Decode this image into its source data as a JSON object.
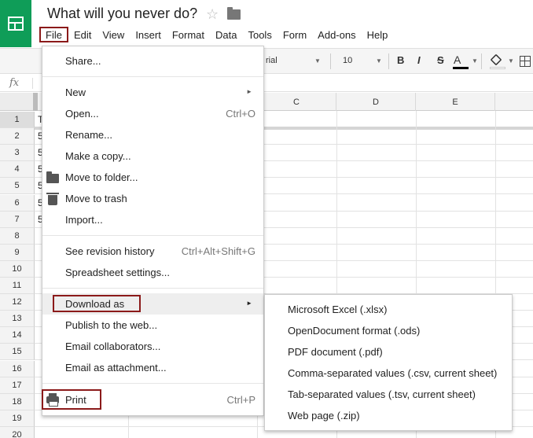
{
  "app": {
    "doc_title": "What will you never do?",
    "logo_icon": "sheets-logo-icon",
    "accent_color": "#0f9d58"
  },
  "menubar": [
    "File",
    "Edit",
    "View",
    "Insert",
    "Format",
    "Data",
    "Tools",
    "Form",
    "Add-ons",
    "Help"
  ],
  "toolbar": {
    "font": "rial",
    "font_size": "10",
    "bold": "B",
    "italic": "I",
    "strike": "S",
    "text_color": "A"
  },
  "formula": {
    "fx": "fx"
  },
  "grid": {
    "columns": [
      "C",
      "D",
      "E"
    ],
    "rows": [
      "1",
      "2",
      "3",
      "4",
      "5",
      "6",
      "7",
      "8",
      "9",
      "10",
      "11",
      "12",
      "13",
      "14",
      "15",
      "16",
      "17",
      "18",
      "19",
      "20"
    ],
    "a_cell_chars": [
      "T",
      "5",
      "5",
      "5",
      "5",
      "5",
      "5"
    ]
  },
  "file_menu": {
    "share": "Share...",
    "new": "New",
    "open": "Open...",
    "open_shortcut": "Ctrl+O",
    "rename": "Rename...",
    "copy": "Make a copy...",
    "move": "Move to folder...",
    "trash": "Move to trash",
    "import": "Import...",
    "revision": "See revision history",
    "revision_shortcut": "Ctrl+Alt+Shift+G",
    "settings": "Spreadsheet settings...",
    "download": "Download as",
    "publish": "Publish to the web...",
    "email_collab": "Email collaborators...",
    "email_attach": "Email as attachment...",
    "print": "Print",
    "print_shortcut": "Ctrl+P"
  },
  "download_menu": [
    "Microsoft Excel (.xlsx)",
    "OpenDocument format (.ods)",
    "PDF document (.pdf)",
    "Comma-separated values (.csv, current sheet)",
    "Tab-separated values (.tsv, current sheet)",
    "Web page (.zip)"
  ]
}
